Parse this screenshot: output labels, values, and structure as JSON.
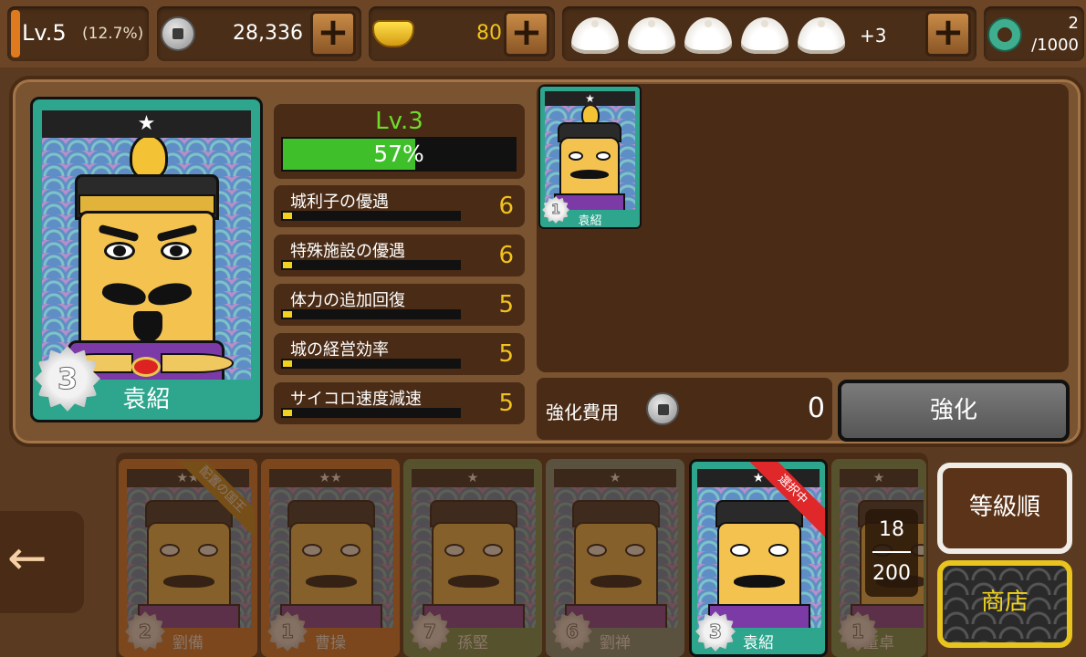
{
  "topbar": {
    "level": "Lv.5",
    "level_pct": "(12.7%)",
    "coins": "28,336",
    "gold": "80",
    "buns_extra": "+3",
    "jade_count": "2",
    "jade_max": "/1000",
    "plus": "+"
  },
  "selected_card": {
    "stars": "★",
    "name": "袁紹",
    "rank": "3"
  },
  "level_box": {
    "level": "Lv.3",
    "exp_percent": "57%",
    "exp_fraction": 0.57
  },
  "stats": [
    {
      "label": "城利子の優遇",
      "value": "6"
    },
    {
      "label": "特殊施設の優遇",
      "value": "6"
    },
    {
      "label": "体力の追加回復",
      "value": "5"
    },
    {
      "label": "城の経営効率",
      "value": "5"
    },
    {
      "label": "サイコロ速度減速",
      "value": "5"
    }
  ],
  "material_card": {
    "stars": "★",
    "rank": "1",
    "name": "袁紹"
  },
  "enhance": {
    "cost_label": "強化費用",
    "cost_value": "0",
    "button_label": "強化"
  },
  "roster": [
    {
      "stars": "★★",
      "rank": "2",
      "name": "劉備",
      "ribbon": "配置の国王",
      "color": "#d97a2a"
    },
    {
      "stars": "★★",
      "rank": "1",
      "name": "曹操",
      "color": "#d97a2a"
    },
    {
      "stars": "★",
      "rank": "7",
      "name": "孫堅",
      "color": "#6d9a5a"
    },
    {
      "stars": "★",
      "rank": "6",
      "name": "劉禅",
      "color": "#7a9a8a"
    },
    {
      "stars": "★",
      "rank": "3",
      "name": "袁紹",
      "ribbon": "選択中",
      "color": "#2ea58d"
    },
    {
      "stars": "★",
      "rank": "1",
      "name": "董卓",
      "color": "#6d9a5a"
    }
  ],
  "counter": {
    "current": "18",
    "max": "200"
  },
  "buttons": {
    "back": "←",
    "sort": "等級順",
    "shop": "商店"
  },
  "colors": {
    "exp_bar": "#3fbf2a",
    "stat_value": "#f2c21e",
    "card_frame": "#2ea58d",
    "shop_border": "#e8c41e"
  }
}
